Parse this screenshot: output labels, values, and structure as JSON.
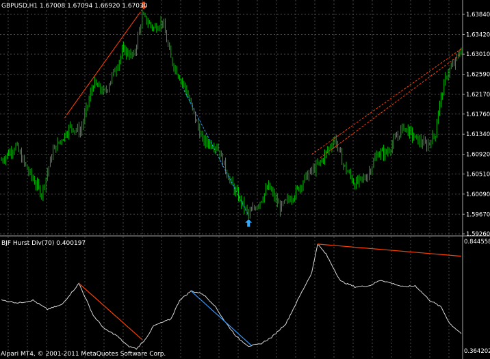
{
  "main_chart": {
    "header": "GBPUSD,H1  1.67008 1.67094 1.66920 1.67030",
    "price_levels": [
      "1.63840",
      "1.63420",
      "1.63010",
      "1.62590",
      "1.62170",
      "1.61760",
      "1.61340",
      "1.60920",
      "1.60510",
      "1.60090",
      "1.59670",
      "1.59260"
    ]
  },
  "indicator": {
    "header": "BJF Hurst Div(70) 0.400197",
    "scale_high": "0.844558",
    "scale_low": "0.364202"
  },
  "footer": {
    "copyright": "Alpari MT4, © 2001-2011 MetaQuotes Software Corp."
  },
  "colors": {
    "background": "#000000",
    "candle": "#00c000",
    "grid": "#4a4a4a",
    "bearish_divergence": "#ff4000",
    "bullish_divergence": "#3399ff",
    "indicator_line": "#d8d8d8",
    "sell_arrow": "#ff4000",
    "buy_arrow": "#33aaff"
  },
  "chart_data": {
    "type": "candlestick",
    "symbol": "GBPUSD",
    "timeframe": "H1",
    "last_quote": {
      "open": 1.67008,
      "high": 1.67094,
      "low": 1.6692,
      "close": 1.6703
    },
    "ylim": [
      1.5926,
      1.6394
    ],
    "indicator": {
      "name": "BJF Hurst Div(70)",
      "last_value": 0.400197,
      "ylim": [
        0.364202,
        0.844558
      ]
    },
    "anchors": [
      {
        "bar": 0,
        "close": 1.608
      },
      {
        "bar": 10,
        "close": 1.611
      },
      {
        "bar": 18,
        "close": 1.606
      },
      {
        "bar": 28,
        "close": 1.601
      },
      {
        "bar": 36,
        "close": 1.61
      },
      {
        "bar": 48,
        "close": 1.615
      },
      {
        "bar": 55,
        "close": 1.614
      },
      {
        "bar": 64,
        "close": 1.624
      },
      {
        "bar": 72,
        "close": 1.622
      },
      {
        "bar": 85,
        "close": 1.631
      },
      {
        "bar": 92,
        "close": 1.6295
      },
      {
        "bar": 98,
        "close": 1.638
      },
      {
        "bar": 106,
        "close": 1.6355
      },
      {
        "bar": 112,
        "close": 1.637
      },
      {
        "bar": 118,
        "close": 1.629
      },
      {
        "bar": 128,
        "close": 1.623
      },
      {
        "bar": 140,
        "close": 1.612
      },
      {
        "bar": 150,
        "close": 1.611
      },
      {
        "bar": 160,
        "close": 1.603
      },
      {
        "bar": 172,
        "close": 1.5965
      },
      {
        "bar": 180,
        "close": 1.5995
      },
      {
        "bar": 186,
        "close": 1.6025
      },
      {
        "bar": 194,
        "close": 1.598
      },
      {
        "bar": 204,
        "close": 1.601
      },
      {
        "bar": 212,
        "close": 1.6045
      },
      {
        "bar": 222,
        "close": 1.6075
      },
      {
        "bar": 232,
        "close": 1.6125
      },
      {
        "bar": 238,
        "close": 1.607
      },
      {
        "bar": 246,
        "close": 1.603
      },
      {
        "bar": 254,
        "close": 1.6045
      },
      {
        "bar": 262,
        "close": 1.6095
      },
      {
        "bar": 268,
        "close": 1.6095
      },
      {
        "bar": 280,
        "close": 1.615
      },
      {
        "bar": 288,
        "close": 1.6125
      },
      {
        "bar": 296,
        "close": 1.611
      },
      {
        "bar": 302,
        "close": 1.6135
      },
      {
        "bar": 304,
        "close": 1.6185
      },
      {
        "bar": 310,
        "close": 1.626
      },
      {
        "bar": 316,
        "close": 1.6285
      },
      {
        "bar": 320,
        "close": 1.6315
      }
    ],
    "indicator_anchors": [
      {
        "bar": 0,
        "value": 0.585
      },
      {
        "bar": 12,
        "value": 0.573
      },
      {
        "bar": 22,
        "value": 0.585
      },
      {
        "bar": 32,
        "value": 0.545
      },
      {
        "bar": 42,
        "value": 0.565
      },
      {
        "bar": 54,
        "value": 0.658
      },
      {
        "bar": 64,
        "value": 0.518
      },
      {
        "bar": 72,
        "value": 0.458
      },
      {
        "bar": 80,
        "value": 0.432
      },
      {
        "bar": 88,
        "value": 0.385
      },
      {
        "bar": 94,
        "value": 0.373
      },
      {
        "bar": 100,
        "value": 0.413
      },
      {
        "bar": 106,
        "value": 0.473
      },
      {
        "bar": 118,
        "value": 0.503
      },
      {
        "bar": 124,
        "value": 0.585
      },
      {
        "bar": 132,
        "value": 0.625
      },
      {
        "bar": 140,
        "value": 0.613
      },
      {
        "bar": 148,
        "value": 0.565
      },
      {
        "bar": 156,
        "value": 0.488
      },
      {
        "bar": 164,
        "value": 0.423
      },
      {
        "bar": 172,
        "value": 0.385
      },
      {
        "bar": 180,
        "value": 0.393
      },
      {
        "bar": 188,
        "value": 0.423
      },
      {
        "bar": 198,
        "value": 0.483
      },
      {
        "bar": 208,
        "value": 0.608
      },
      {
        "bar": 216,
        "value": 0.705
      },
      {
        "bar": 220,
        "value": 0.83
      },
      {
        "bar": 226,
        "value": 0.785
      },
      {
        "bar": 236,
        "value": 0.668
      },
      {
        "bar": 246,
        "value": 0.643
      },
      {
        "bar": 256,
        "value": 0.648
      },
      {
        "bar": 264,
        "value": 0.673
      },
      {
        "bar": 272,
        "value": 0.658
      },
      {
        "bar": 280,
        "value": 0.643
      },
      {
        "bar": 288,
        "value": 0.648
      },
      {
        "bar": 298,
        "value": 0.585
      },
      {
        "bar": 306,
        "value": 0.555
      },
      {
        "bar": 312,
        "value": 0.483
      },
      {
        "bar": 320,
        "value": 0.44
      }
    ],
    "price_trendlines": [
      {
        "kind": "bearish_divergence",
        "from": {
          "bar": 46,
          "price": 1.6177
        },
        "to": {
          "bar": 98,
          "price": 1.6394
        },
        "style": "dashed"
      },
      {
        "kind": "bearish_divergence",
        "from": {
          "bar": 44,
          "price": 1.6168
        },
        "to": {
          "bar": 96,
          "price": 1.6386
        },
        "style": "dashed"
      },
      {
        "kind": "bullish_divergence",
        "from": {
          "bar": 126,
          "price": 1.6232
        },
        "to": {
          "bar": 172,
          "price": 1.5965
        },
        "style": "dashed"
      },
      {
        "kind": "bearish_divergence",
        "from": {
          "bar": 216,
          "price": 1.6092
        },
        "to": {
          "bar": 320,
          "price": 1.6312
        },
        "style": "dashed"
      },
      {
        "kind": "bearish_divergence",
        "from": {
          "bar": 222,
          "price": 1.6085
        },
        "to": {
          "bar": 320,
          "price": 1.6302
        },
        "style": "dashed"
      }
    ],
    "indicator_trendlines": [
      {
        "kind": "bearish_divergence",
        "from": {
          "bar": 54,
          "value": 0.658
        },
        "to": {
          "bar": 98,
          "value": 0.413
        }
      },
      {
        "kind": "bullish_divergence",
        "from": {
          "bar": 132,
          "value": 0.625
        },
        "to": {
          "bar": 174,
          "value": 0.387
        }
      },
      {
        "kind": "bearish_divergence",
        "from": {
          "bar": 220,
          "value": 0.83
        },
        "to": {
          "bar": 320,
          "value": 0.777
        }
      }
    ],
    "signals": [
      {
        "type": "sell",
        "bar": 99,
        "price": 1.6396
      },
      {
        "type": "buy",
        "bar": 172,
        "price": 1.5955
      }
    ]
  }
}
